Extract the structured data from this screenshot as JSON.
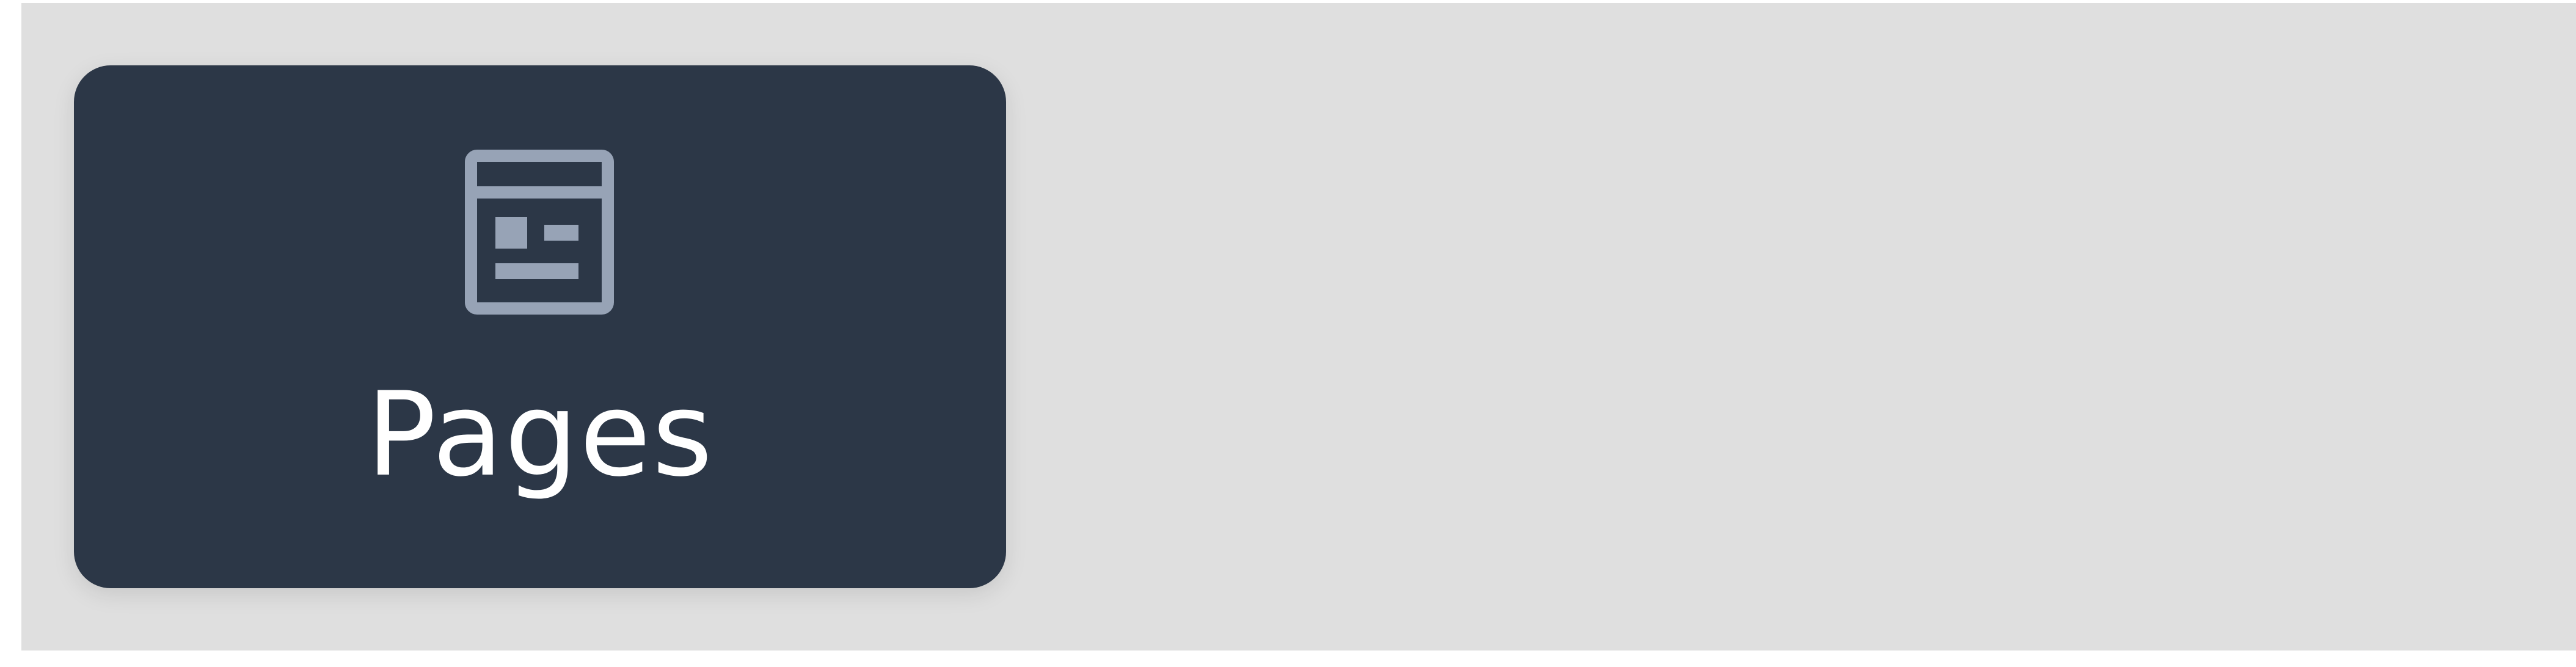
{
  "colors": {
    "background": "#dfdfdf",
    "tile": "#2c3747",
    "icon": "#97a3b6",
    "label": "#ffffff"
  },
  "tile": {
    "label": "Pages",
    "icon": "page-layout-icon"
  }
}
